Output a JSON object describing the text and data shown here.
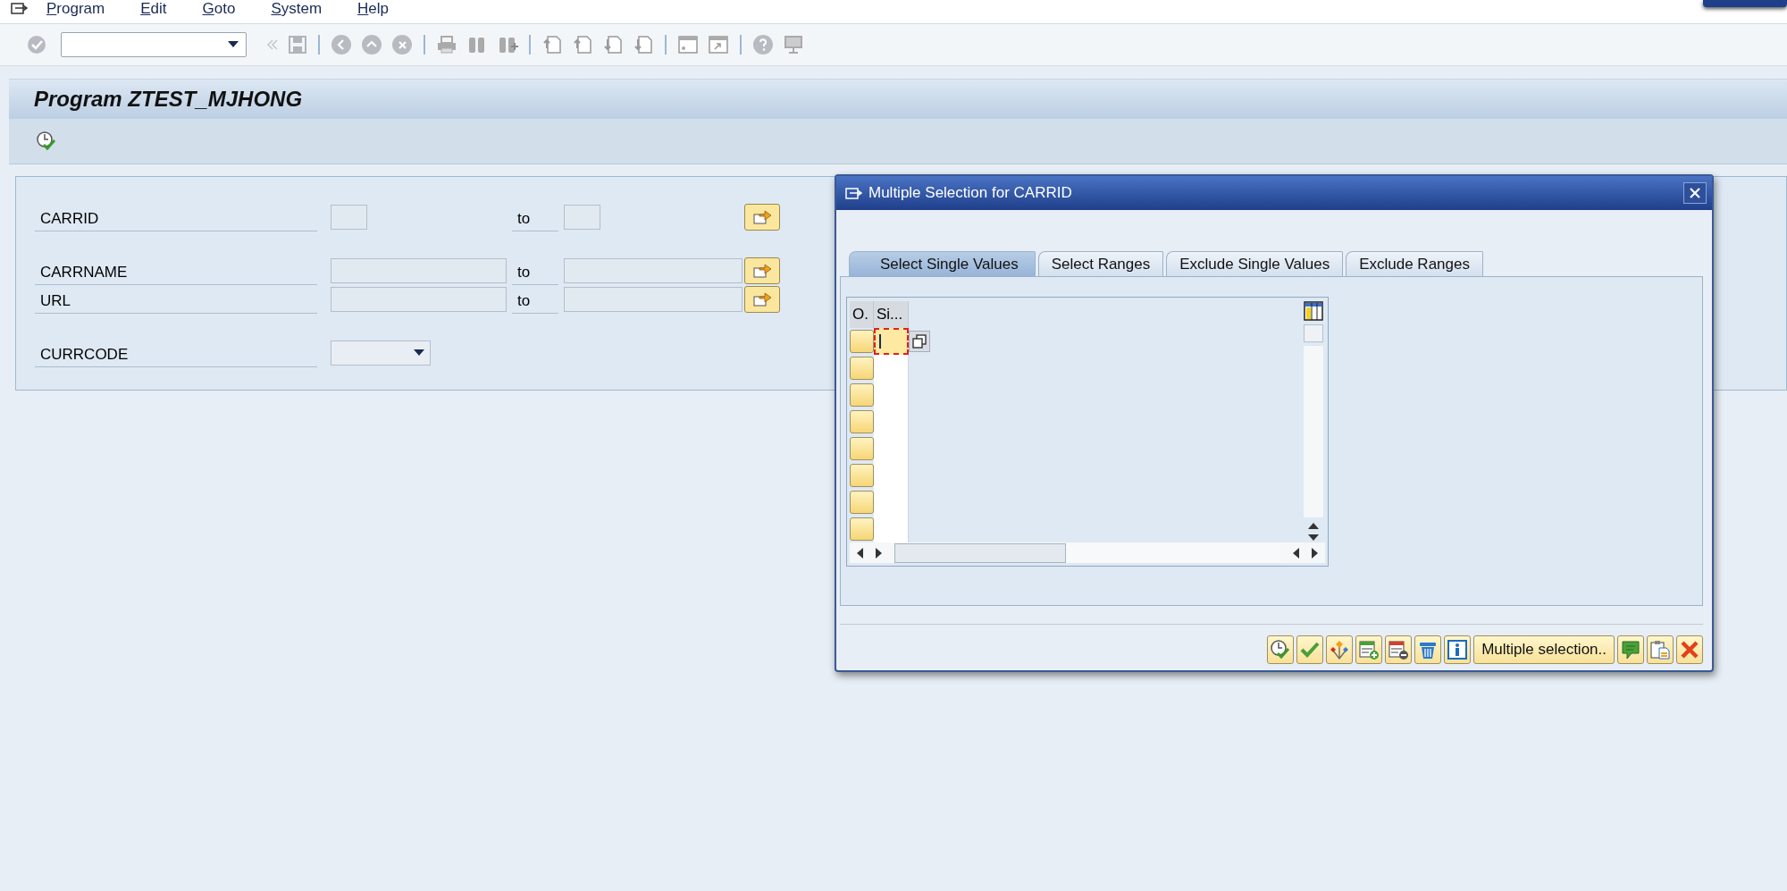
{
  "menu": [
    {
      "label": "Program"
    },
    {
      "label": "Edit"
    },
    {
      "label": "Goto"
    },
    {
      "label": "System"
    },
    {
      "label": "Help"
    }
  ],
  "title": "Program ZTEST_MJHONG",
  "selection_screen": {
    "groups": [
      [
        {
          "kind": "short_range",
          "label": "CARRID",
          "to": "to"
        }
      ],
      [
        {
          "kind": "range",
          "label": "CARRNAME",
          "to": "to"
        },
        {
          "kind": "range",
          "label": "URL",
          "to": "to"
        }
      ],
      [
        {
          "kind": "dropdown",
          "label": "CURRCODE"
        }
      ]
    ]
  },
  "dialog": {
    "title": "Multiple Selection for CARRID",
    "tabs": [
      {
        "label": "Select Single Values",
        "selected": true
      },
      {
        "label": "Select Ranges",
        "selected": false
      },
      {
        "label": "Exclude Single Values",
        "selected": false
      },
      {
        "label": "Exclude Ranges",
        "selected": false
      }
    ],
    "table": {
      "columns": [
        "O.",
        "Si..."
      ],
      "rows": [
        {
          "focused": true
        },
        {
          "focused": false
        },
        {
          "focused": false
        },
        {
          "focused": false
        },
        {
          "focused": false
        },
        {
          "focused": false
        },
        {
          "focused": false
        },
        {
          "focused": false
        }
      ]
    },
    "buttons": [
      {
        "kind": "execute"
      },
      {
        "kind": "confirm"
      },
      {
        "kind": "hierarchy"
      },
      {
        "kind": "insert_row"
      },
      {
        "kind": "delete_row"
      },
      {
        "kind": "trash"
      },
      {
        "kind": "info"
      },
      {
        "kind": "text",
        "label": "Multiple selection.."
      },
      {
        "kind": "import"
      },
      {
        "kind": "paste"
      },
      {
        "kind": "cancel"
      }
    ]
  }
}
